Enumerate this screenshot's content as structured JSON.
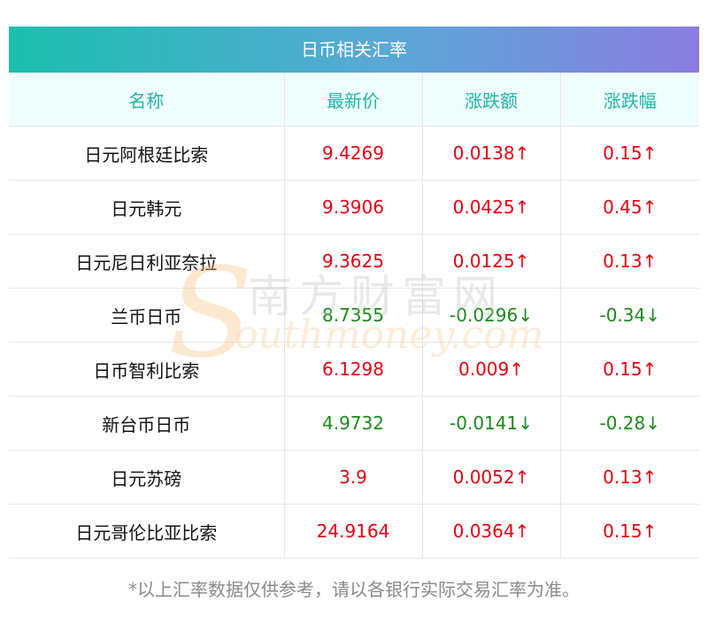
{
  "title": "日币相关汇率",
  "headers": [
    "名称",
    "最新价",
    "涨跌额",
    "涨跌幅"
  ],
  "rows": [
    {
      "name": "日元阿根廷比索",
      "price": "9.4269",
      "change": "0.0138↑",
      "pct": "0.15↑",
      "dir": "up"
    },
    {
      "name": "日元韩元",
      "price": "9.3906",
      "change": "0.0425↑",
      "pct": "0.45↑",
      "dir": "up"
    },
    {
      "name": "日元尼日利亚奈拉",
      "price": "9.3625",
      "change": "0.0125↑",
      "pct": "0.13↑",
      "dir": "up"
    },
    {
      "name": "兰币日币",
      "price": "8.7355",
      "change": "-0.0296↓",
      "pct": "-0.34↓",
      "dir": "down"
    },
    {
      "name": "日币智利比索",
      "price": "6.1298",
      "change": "0.009↑",
      "pct": "0.15↑",
      "dir": "up"
    },
    {
      "name": "新台币日币",
      "price": "4.9732",
      "change": "-0.0141↓",
      "pct": "-0.28↓",
      "dir": "down"
    },
    {
      "name": "日元苏磅",
      "price": "3.9",
      "change": "0.0052↑",
      "pct": "0.13↑",
      "dir": "up"
    },
    {
      "name": "日元哥伦比亚比索",
      "price": "24.9164",
      "change": "0.0364↑",
      "pct": "0.15↑",
      "dir": "up"
    }
  ],
  "note": "*以上汇率数据仅供参考，请以各银行实际交易汇率为准。",
  "watermark": {
    "cn": "南方财富网",
    "en": "outhmoney.com",
    "s": "S"
  },
  "colors": {
    "up": "#e60012",
    "down": "#1a8a1a",
    "header_text": "#21b5a5"
  }
}
